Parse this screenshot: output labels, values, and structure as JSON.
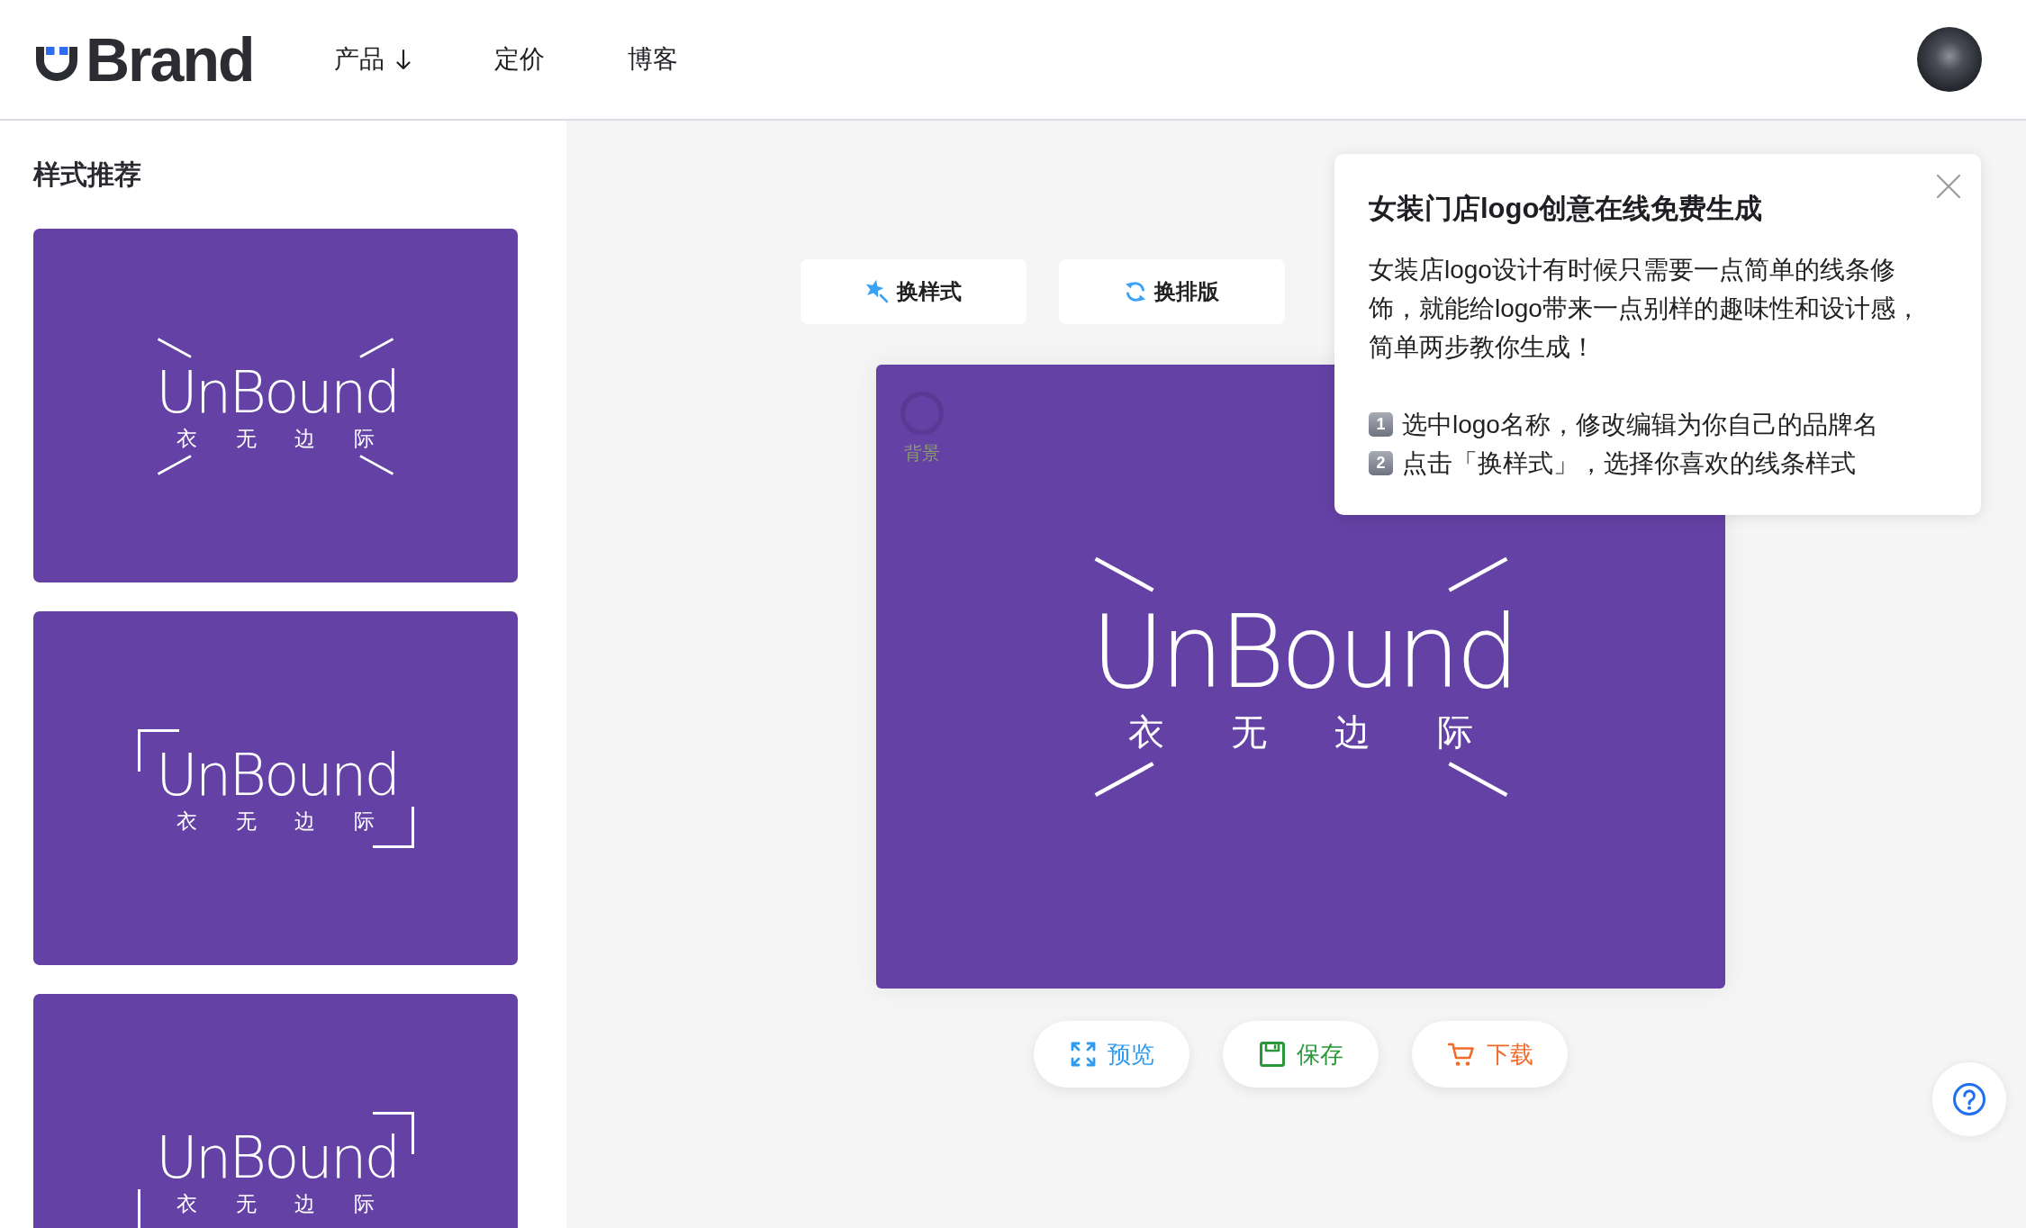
{
  "header": {
    "logo_text": "Brand",
    "nav": [
      {
        "label": "产品",
        "kind": "dropdown"
      },
      {
        "label": "定价",
        "kind": "link"
      },
      {
        "label": "博客",
        "kind": "link"
      }
    ]
  },
  "sidebar": {
    "title": "样式推荐",
    "styles": [
      {
        "kind": "rays",
        "name": "UnBound",
        "tagline": "衣 无 边 际"
      },
      {
        "kind": "brackets",
        "name": "UnBound",
        "tagline": "衣 无 边 际"
      },
      {
        "kind": "mirrored",
        "name": "UnBound",
        "tagline": "衣 无 边 际"
      }
    ]
  },
  "toolbar": [
    {
      "label": "换样式",
      "kind": "style"
    },
    {
      "label": "换排版",
      "kind": "layout"
    }
  ],
  "canvas": {
    "background_label": "背景",
    "logo": {
      "kind": "rays",
      "name": "UnBound",
      "tagline": "衣 无 边 际"
    }
  },
  "actions": [
    {
      "label": "预览",
      "kind": "preview"
    },
    {
      "label": "保存",
      "kind": "save"
    },
    {
      "label": "下载",
      "kind": "download"
    }
  ],
  "popup": {
    "title": "女装门店logo创意在线免费生成",
    "body": "女装店logo设计有时候只需要一点简单的线条修饰，就能给logo带来一点别样的趣味性和设计感，简单两步教你生成！",
    "steps": [
      {
        "number": "1",
        "text": "选中logo名称，修改编辑为你自己的品牌名"
      },
      {
        "number": "2",
        "text": "点击「换样式」，选择你喜欢的线条样式"
      }
    ]
  }
}
